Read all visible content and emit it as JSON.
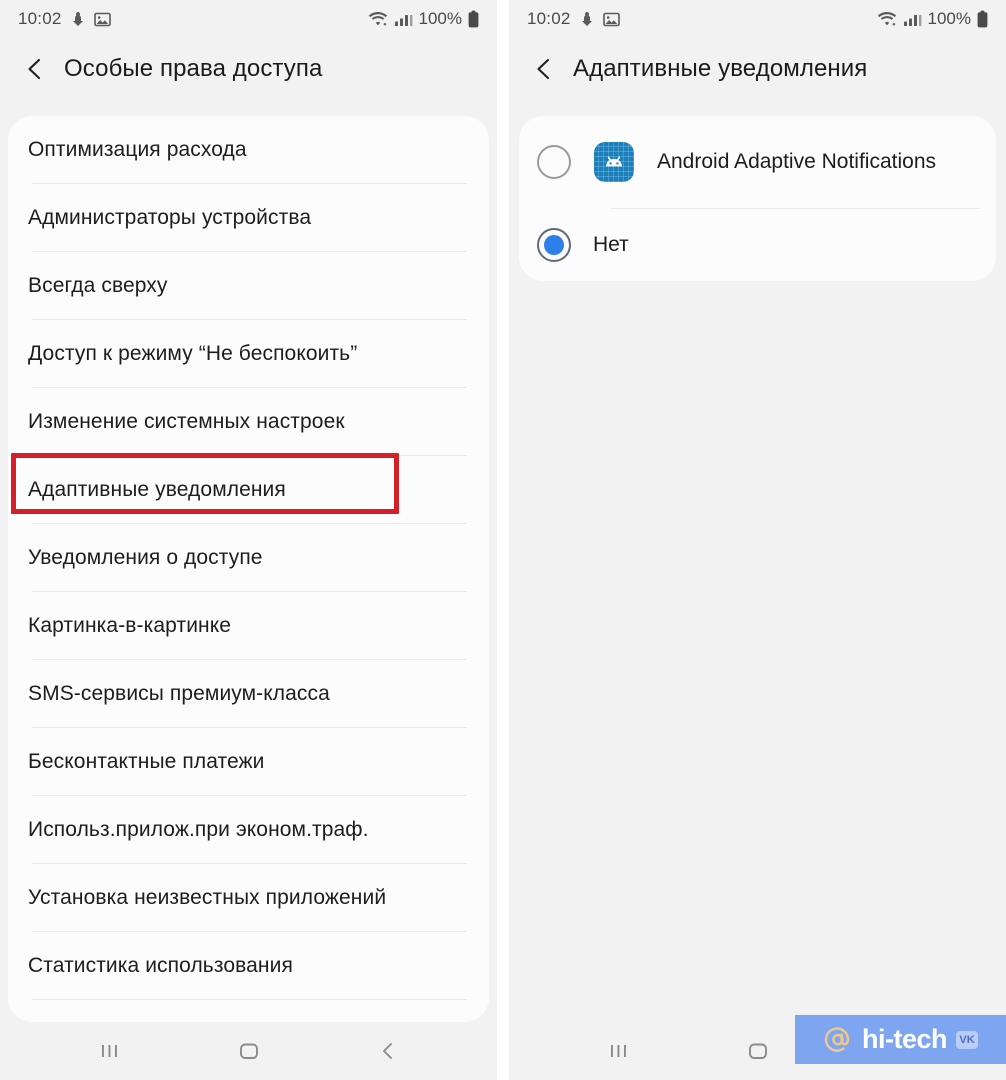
{
  "theme": {
    "background": "#f2f2f2",
    "card_background": "#fcfcfc",
    "text_primary": "#1d1d1d",
    "accent_blue": "#2f7fe8",
    "highlight_red": "#d32029",
    "watermark_bg": "#7ea6f0"
  },
  "left_panel": {
    "status_bar": {
      "time": "10:02",
      "icons": [
        "download-icon",
        "image-icon"
      ],
      "wifi_icon": "wifi-icon",
      "signal_icon": "signal-bars-icon",
      "battery_percent": "100%",
      "battery_icon": "battery-full-icon"
    },
    "header": {
      "back_icon": "back-chevron-icon",
      "title": "Особые права доступа"
    },
    "list_items": [
      {
        "label": "Оптимизация расхода",
        "highlighted": false
      },
      {
        "label": "Администраторы устройства",
        "highlighted": false
      },
      {
        "label": "Всегда сверху",
        "highlighted": false
      },
      {
        "label": "Доступ к режиму “Не беспокоить”",
        "highlighted": false
      },
      {
        "label": "Изменение системных настроек",
        "highlighted": false
      },
      {
        "label": "Адаптивные уведомления",
        "highlighted": true
      },
      {
        "label": "Уведомления о доступе",
        "highlighted": false
      },
      {
        "label": "Картинка-в-картинке",
        "highlighted": false
      },
      {
        "label": "SMS-сервисы премиум-класса",
        "highlighted": false
      },
      {
        "label": "Бесконтактные платежи",
        "highlighted": false
      },
      {
        "label": "Использ.прилож.при эконом.траф.",
        "highlighted": false
      },
      {
        "label": "Установка неизвестных приложений",
        "highlighted": false
      },
      {
        "label": "Статистика использования",
        "highlighted": false
      }
    ],
    "nav_bar": {
      "recents_icon": "recents-icon",
      "home_icon": "home-icon",
      "back_icon": "back-icon"
    }
  },
  "right_panel": {
    "status_bar": {
      "time": "10:02",
      "icons": [
        "download-icon",
        "image-icon"
      ],
      "wifi_icon": "wifi-icon",
      "signal_icon": "signal-bars-icon",
      "battery_percent": "100%",
      "battery_icon": "battery-full-icon"
    },
    "header": {
      "back_icon": "back-chevron-icon",
      "title": "Адаптивные уведомления"
    },
    "radio_options": [
      {
        "label": "Android Adaptive Notifications",
        "selected": false,
        "icon": "android-adaptive-notifications-icon",
        "has_icon": true
      },
      {
        "label": "Нет",
        "selected": true,
        "icon": null,
        "has_icon": false
      }
    ],
    "nav_bar": {
      "recents_icon": "recents-icon",
      "home_icon": "home-icon",
      "back_icon": "back-icon"
    }
  },
  "watermark": {
    "at_icon": "at-sign-icon",
    "text": "hi-tech",
    "badge": "VK"
  }
}
